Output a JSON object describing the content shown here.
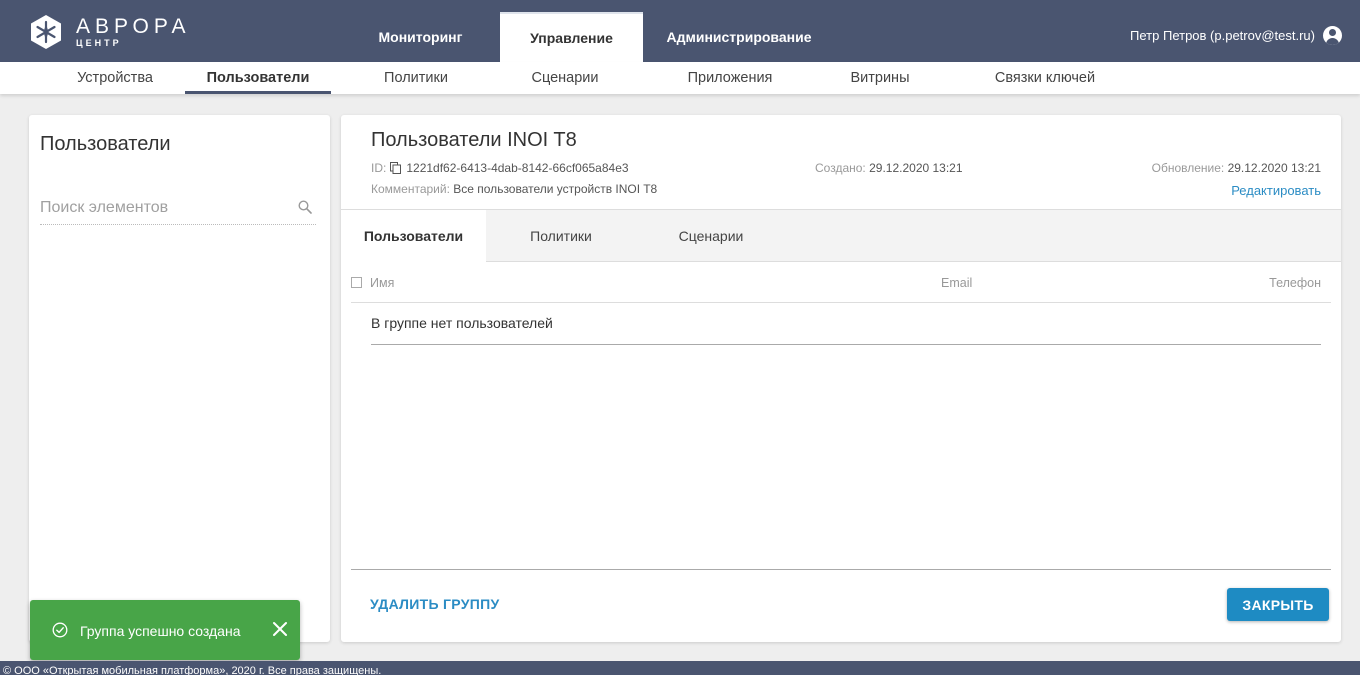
{
  "app": {
    "logo_title": "АВРОРА",
    "logo_subtitle": "ЦЕНТР"
  },
  "topnav": {
    "tabs": [
      {
        "label": "Мониторинг",
        "active": false
      },
      {
        "label": "Управление",
        "active": true
      },
      {
        "label": "Администрирование",
        "active": false
      }
    ]
  },
  "user": {
    "name": "Петр Петров (p.petrov@test.ru)",
    "icon": "user-circle-icon"
  },
  "subnav": {
    "items": [
      {
        "label": "Устройства",
        "active": false
      },
      {
        "label": "Пользователи",
        "active": true
      },
      {
        "label": "Политики",
        "active": false
      },
      {
        "label": "Сценарии",
        "active": false
      },
      {
        "label": "Приложения",
        "active": false
      },
      {
        "label": "Витрины",
        "active": false
      },
      {
        "label": "Связки ключей",
        "active": false
      }
    ]
  },
  "left_panel": {
    "title": "Пользователи",
    "search_placeholder": "Поиск элементов"
  },
  "group": {
    "title": "Пользователи INOI T8",
    "id_label": "ID:",
    "id_value": "1221df62-6413-4dab-8142-66cf065a84e3",
    "comment_label": "Комментарий:",
    "comment_value": "Все пользователи устройств INOI T8",
    "created_label": "Создано:",
    "created_value": "29.12.2020 13:21",
    "updated_label": "Обновление:",
    "updated_value": "29.12.2020 13:21",
    "edit_label": "Редактировать"
  },
  "detail_tabs": [
    {
      "label": "Пользователи",
      "active": true
    },
    {
      "label": "Политики",
      "active": false
    },
    {
      "label": "Сценарии",
      "active": false
    }
  ],
  "table": {
    "columns": [
      "Имя",
      "Email",
      "Телефон"
    ],
    "empty_text": "В группе нет пользователей"
  },
  "actions": {
    "delete_label": "УДАЛИТЬ ГРУППУ",
    "close_label": "ЗАКРЫТЬ"
  },
  "toast": {
    "message": "Группа успешно создана",
    "color": "#48a548"
  },
  "footer": {
    "text": "© ООО «Открытая мобильная платформа», 2020 г. Все права защищены."
  },
  "colors": {
    "header": "#4a5570",
    "accent": "#1e8bc3",
    "link": "#2b8cc4"
  }
}
